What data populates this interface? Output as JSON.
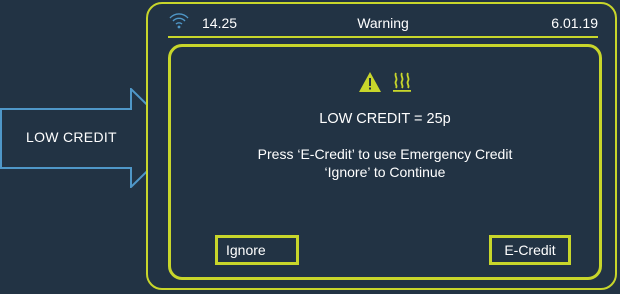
{
  "callout": {
    "label": "LOW CREDIT"
  },
  "status_bar": {
    "time": "14.25",
    "title": "Warning",
    "date": "6.01.19",
    "icon": "wifi-signal-icon"
  },
  "dialog": {
    "icons": [
      "warning-triangle-icon",
      "heating-icon"
    ],
    "heading": "LOW CREDIT = 25p",
    "message_line1": "Press ‘E-Credit’ to use Emergency Credit",
    "message_line2": "‘Ignore’ to Continue",
    "ignore_label": "Ignore",
    "ecredit_label": "E-Credit"
  },
  "colors": {
    "background": "#223344",
    "accent": "#c8d62b",
    "callout_stroke": "#4f97c8",
    "text": "#ffffff"
  }
}
